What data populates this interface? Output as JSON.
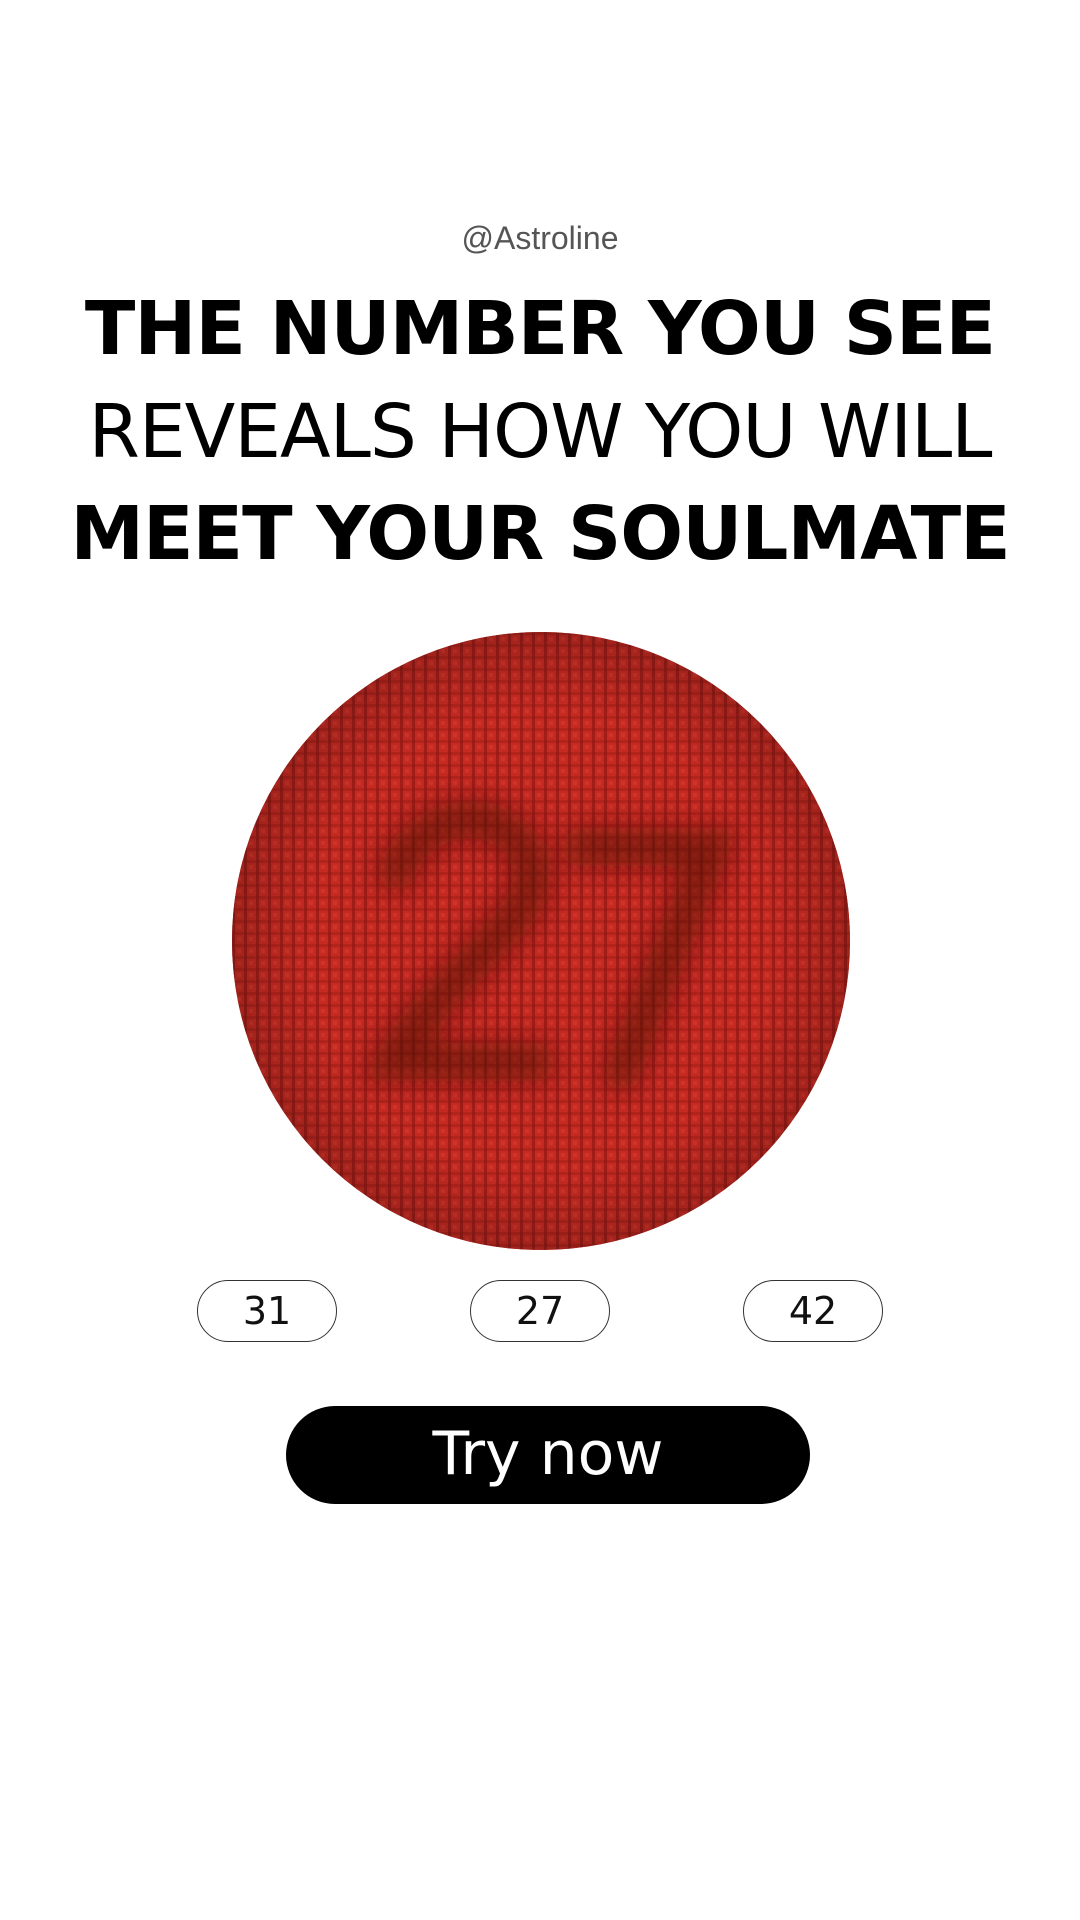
{
  "handle": "@Astroline",
  "headline": {
    "line1": "THE NUMBER YOU SEE",
    "line2": "REVEALS HOW YOU WILL",
    "line3": "MEET YOUR SOULMATE"
  },
  "test_image": {
    "icon": "color-vision-test-plate",
    "base_color": "#c42a22",
    "pattern_color": "#5a0a08"
  },
  "answers": [
    "31",
    "27",
    "42"
  ],
  "cta_label": "Try now"
}
